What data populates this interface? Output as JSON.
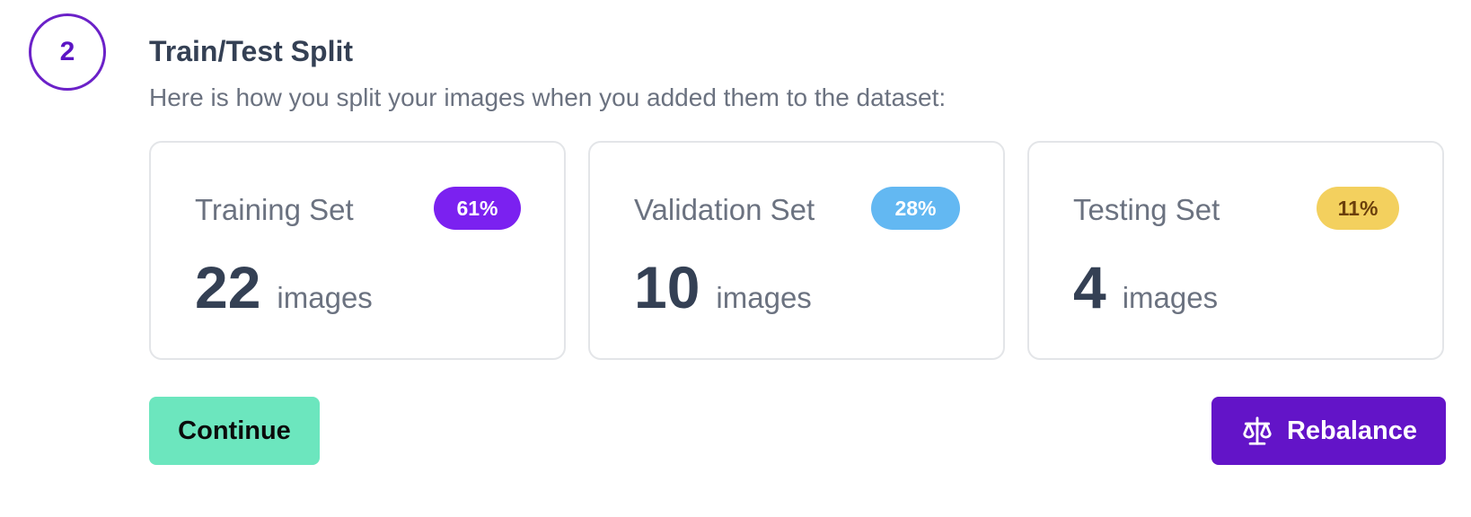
{
  "step": {
    "number": "2"
  },
  "header": {
    "title": "Train/Test Split",
    "subtitle": "Here is how you split your images when you added them to the dataset:"
  },
  "cards": [
    {
      "label": "Training Set",
      "percent": "61%",
      "count": "22",
      "unit": "images",
      "badge_color": "#7b21f0"
    },
    {
      "label": "Validation Set",
      "percent": "28%",
      "count": "10",
      "unit": "images",
      "badge_color": "#63b8f2"
    },
    {
      "label": "Testing Set",
      "percent": "11%",
      "count": "4",
      "unit": "images",
      "badge_color": "#f3d05e"
    }
  ],
  "actions": {
    "continue_label": "Continue",
    "continue_color": "#6ce6be",
    "rebalance_label": "Rebalance",
    "rebalance_icon": "scale-icon",
    "rebalance_color": "#6314c8"
  }
}
